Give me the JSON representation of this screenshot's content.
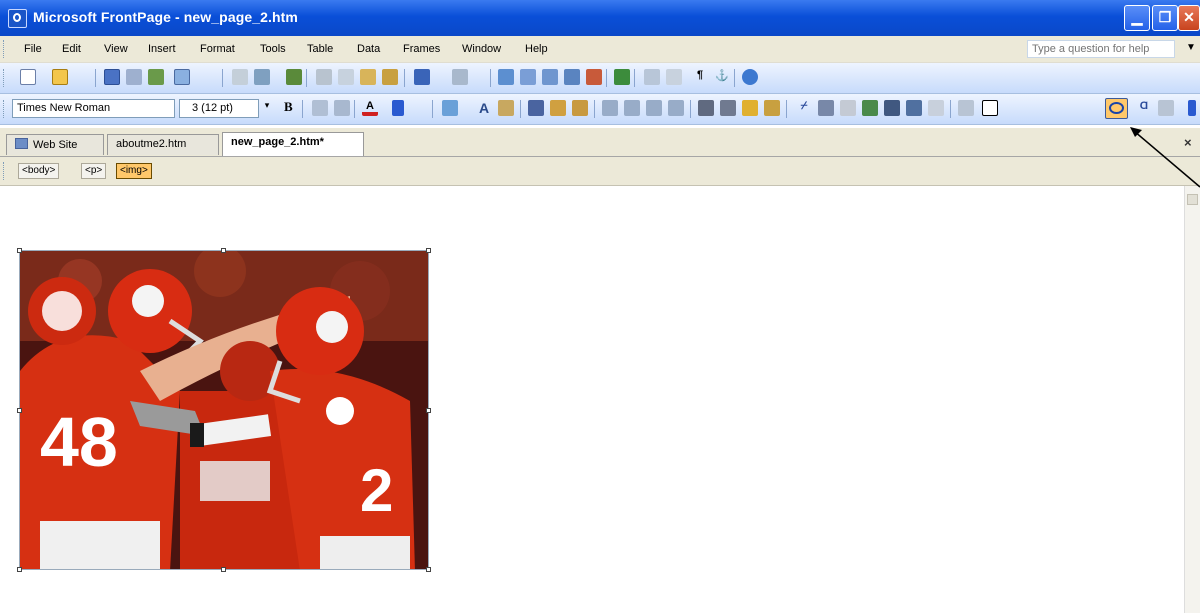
{
  "window": {
    "title": "Microsoft FrontPage - new_page_2.htm",
    "buttons": [
      "minimize",
      "restore",
      "close"
    ]
  },
  "menubar": {
    "items": [
      "File",
      "Edit",
      "View",
      "Insert",
      "Format",
      "Tools",
      "Table",
      "Data",
      "Frames",
      "Window",
      "Help"
    ],
    "help_placeholder": "Type a question for help"
  },
  "formatting": {
    "font": "Times New Roman",
    "size": "3 (12 pt)",
    "bold": "B"
  },
  "tabs": [
    {
      "label": "Web Site",
      "active": false
    },
    {
      "label": "aboutme2.htm",
      "active": false
    },
    {
      "label": "new_page_2.htm*",
      "active": true
    }
  ],
  "quick_tags": [
    "<body>",
    "<p>",
    "<img>"
  ],
  "selected_tag": "<img>",
  "colors": {
    "titlebar": "#0a4fd8",
    "toolbar": "#c7dbfb",
    "highlight": "#ffc86a",
    "jersey_red": "#d63012"
  },
  "image": {
    "description_icon": "football-players-photo"
  }
}
